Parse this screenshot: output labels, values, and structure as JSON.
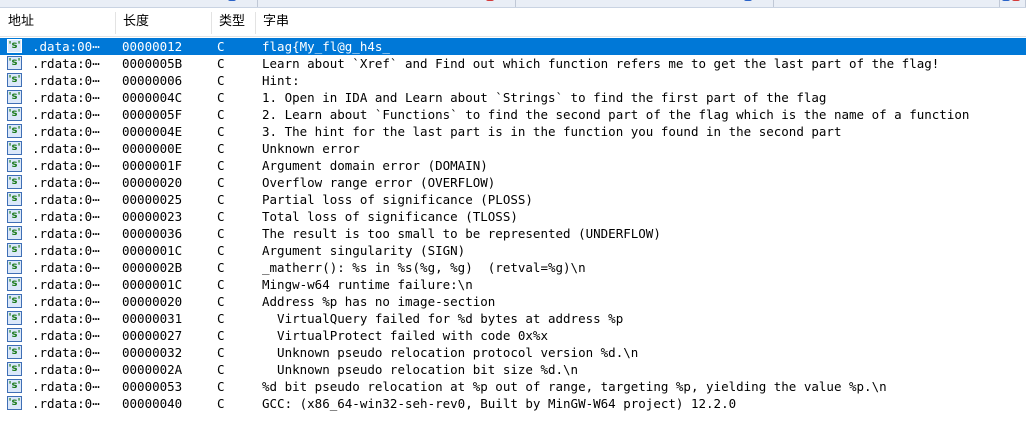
{
  "window": {
    "tab_colors": [
      "#2a62c8",
      "#d43a3a",
      "#2a62c8",
      "#2a62c8",
      "#d43a3a"
    ]
  },
  "columns": {
    "address": "地址",
    "length": "长度",
    "type": "类型",
    "string": "字串"
  },
  "icon": {
    "name": "string-icon",
    "glyph": "'s'"
  },
  "selected_row": 0,
  "rows": [
    {
      "address": ".data:00⋯",
      "length": "00000012",
      "type": "C",
      "string": "flag{My_fl@g_h4s_"
    },
    {
      "address": ".rdata:0⋯",
      "length": "0000005B",
      "type": "C",
      "string": "Learn about `Xref` and Find out which function refers me to get the last part of the flag!"
    },
    {
      "address": ".rdata:0⋯",
      "length": "00000006",
      "type": "C",
      "string": "Hint:"
    },
    {
      "address": ".rdata:0⋯",
      "length": "0000004C",
      "type": "C",
      "string": "1. Open in IDA and Learn about `Strings` to find the first part of the flag"
    },
    {
      "address": ".rdata:0⋯",
      "length": "0000005F",
      "type": "C",
      "string": "2. Learn about `Functions` to find the second part of the flag which is the name of a function"
    },
    {
      "address": ".rdata:0⋯",
      "length": "0000004E",
      "type": "C",
      "string": "3. The hint for the last part is in the function you found in the second part"
    },
    {
      "address": ".rdata:0⋯",
      "length": "0000000E",
      "type": "C",
      "string": "Unknown error"
    },
    {
      "address": ".rdata:0⋯",
      "length": "0000001F",
      "type": "C",
      "string": "Argument domain error (DOMAIN)"
    },
    {
      "address": ".rdata:0⋯",
      "length": "00000020",
      "type": "C",
      "string": "Overflow range error (OVERFLOW)"
    },
    {
      "address": ".rdata:0⋯",
      "length": "00000025",
      "type": "C",
      "string": "Partial loss of significance (PLOSS)"
    },
    {
      "address": ".rdata:0⋯",
      "length": "00000023",
      "type": "C",
      "string": "Total loss of significance (TLOSS)"
    },
    {
      "address": ".rdata:0⋯",
      "length": "00000036",
      "type": "C",
      "string": "The result is too small to be represented (UNDERFLOW)"
    },
    {
      "address": ".rdata:0⋯",
      "length": "0000001C",
      "type": "C",
      "string": "Argument singularity (SIGN)"
    },
    {
      "address": ".rdata:0⋯",
      "length": "0000002B",
      "type": "C",
      "string": "_matherr(): %s in %s(%g, %g)  (retval=%g)\\n"
    },
    {
      "address": ".rdata:0⋯",
      "length": "0000001C",
      "type": "C",
      "string": "Mingw-w64 runtime failure:\\n"
    },
    {
      "address": ".rdata:0⋯",
      "length": "00000020",
      "type": "C",
      "string": "Address %p has no image-section"
    },
    {
      "address": ".rdata:0⋯",
      "length": "00000031",
      "type": "C",
      "string": "  VirtualQuery failed for %d bytes at address %p"
    },
    {
      "address": ".rdata:0⋯",
      "length": "00000027",
      "type": "C",
      "string": "  VirtualProtect failed with code 0x%x"
    },
    {
      "address": ".rdata:0⋯",
      "length": "00000032",
      "type": "C",
      "string": "  Unknown pseudo relocation protocol version %d.\\n"
    },
    {
      "address": ".rdata:0⋯",
      "length": "0000002A",
      "type": "C",
      "string": "  Unknown pseudo relocation bit size %d.\\n"
    },
    {
      "address": ".rdata:0⋯",
      "length": "00000053",
      "type": "C",
      "string": "%d bit pseudo relocation at %p out of range, targeting %p, yielding the value %p.\\n"
    },
    {
      "address": ".rdata:0⋯",
      "length": "00000040",
      "type": "C",
      "string": "GCC: (x86_64-win32-seh-rev0, Built by MinGW-W64 project) 12.2.0"
    }
  ]
}
